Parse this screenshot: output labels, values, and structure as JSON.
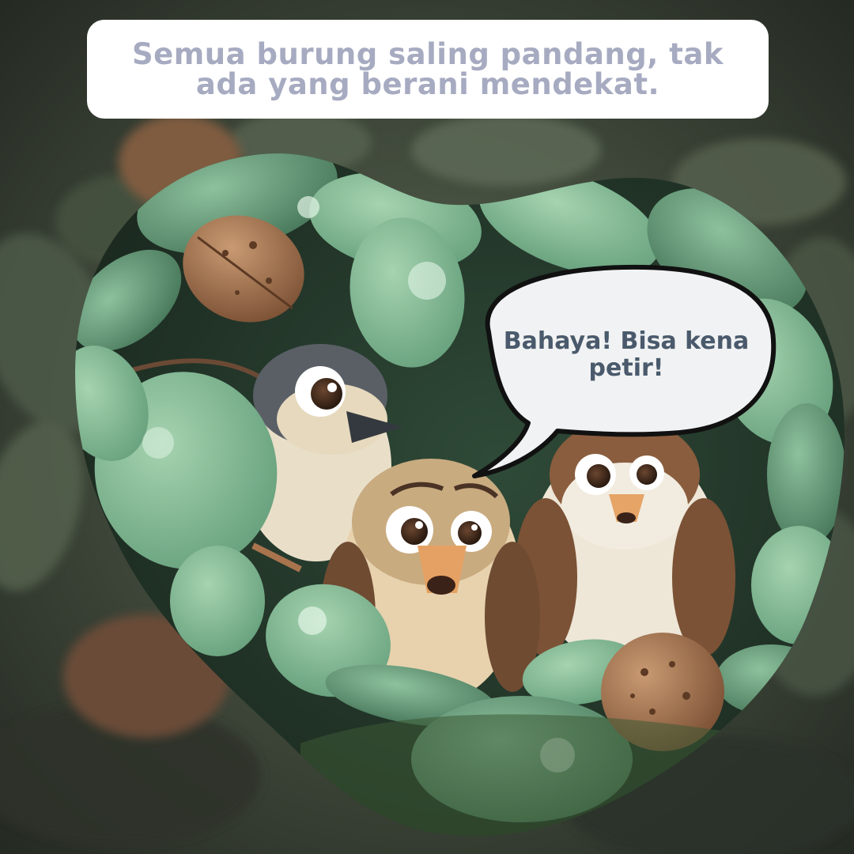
{
  "caption": {
    "text": "Semua burung saling pandang, tak ada yang berani mendekat."
  },
  "speech_bubble": {
    "text": "Bahaya! Bisa kena petir!"
  },
  "colors": {
    "caption_text": "#a7abc1",
    "bubble_text": "#4a5a6c",
    "leaf_green": "#8fbf9e",
    "walnut_brown": "#a8754e"
  }
}
